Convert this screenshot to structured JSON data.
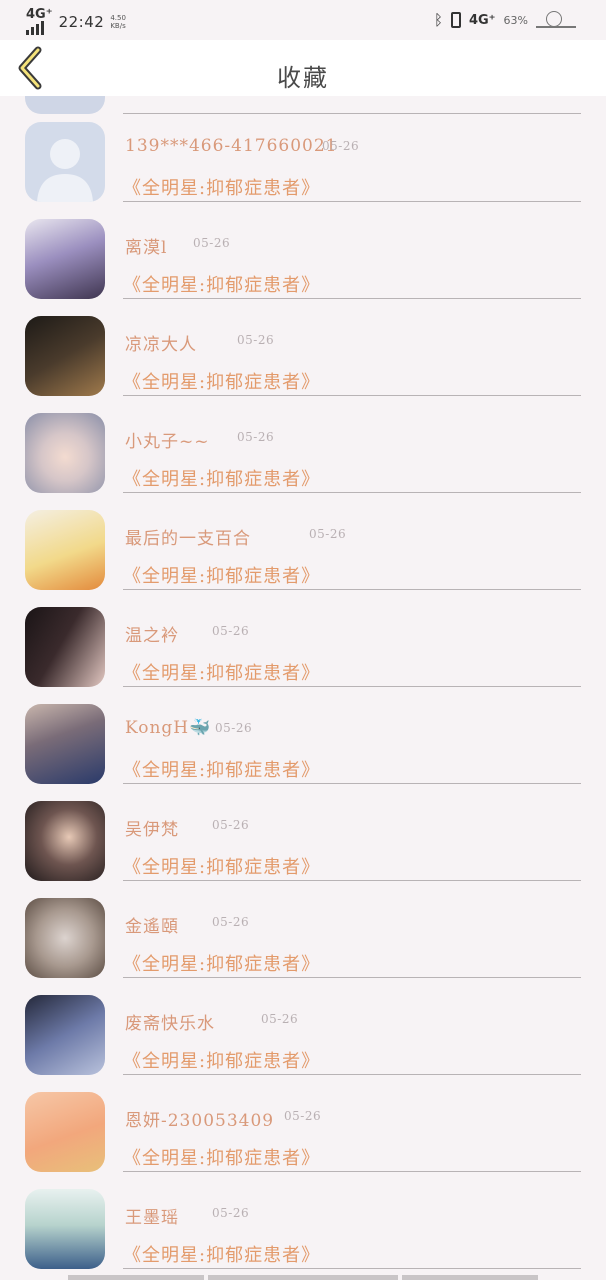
{
  "status_bar": {
    "network": "4G⁺",
    "time": "22:42",
    "speed_value": "4.50",
    "speed_unit": "KB/s",
    "network2": "4G⁺",
    "battery": "63%"
  },
  "header": {
    "title": "收藏",
    "back_icon": "chevron-left-icon"
  },
  "items": [
    {
      "name": "",
      "date": "",
      "quote": ""
    },
    {
      "name": "139***466-417660021",
      "date": "05-26",
      "quote": "《全明星:抑郁症患者》"
    },
    {
      "name": "离漠l",
      "date": "05-26",
      "quote": "《全明星:抑郁症患者》"
    },
    {
      "name": "凉凉大人",
      "date": "05-26",
      "quote": "《全明星:抑郁症患者》"
    },
    {
      "name": "小丸子~~",
      "date": "05-26",
      "quote": "《全明星:抑郁症患者》"
    },
    {
      "name": "最后的一支百合",
      "date": "05-26",
      "quote": "《全明星:抑郁症患者》"
    },
    {
      "name": "温之衿",
      "date": "05-26",
      "quote": "《全明星:抑郁症患者》"
    },
    {
      "name": "KongH🐳",
      "date": "05-26",
      "quote": "《全明星:抑郁症患者》"
    },
    {
      "name": "吴伊梵",
      "date": "05-26",
      "quote": "《全明星:抑郁症患者》"
    },
    {
      "name": "金遙頤",
      "date": "05-26",
      "quote": "《全明星:抑郁症患者》"
    },
    {
      "name": "废斋快乐水",
      "date": "05-26",
      "quote": "《全明星:抑郁症患者》"
    },
    {
      "name": "恩妍-230053409",
      "date": "05-26",
      "quote": "《全明星:抑郁症患者》"
    },
    {
      "name": "王墨瑶",
      "date": "05-26",
      "quote": "《全明星:抑郁症患者》"
    }
  ],
  "colors": {
    "name": "#d9997a",
    "quote": "#e39b6c",
    "date": "#b9b0b3",
    "background": "#f7f3f5"
  }
}
